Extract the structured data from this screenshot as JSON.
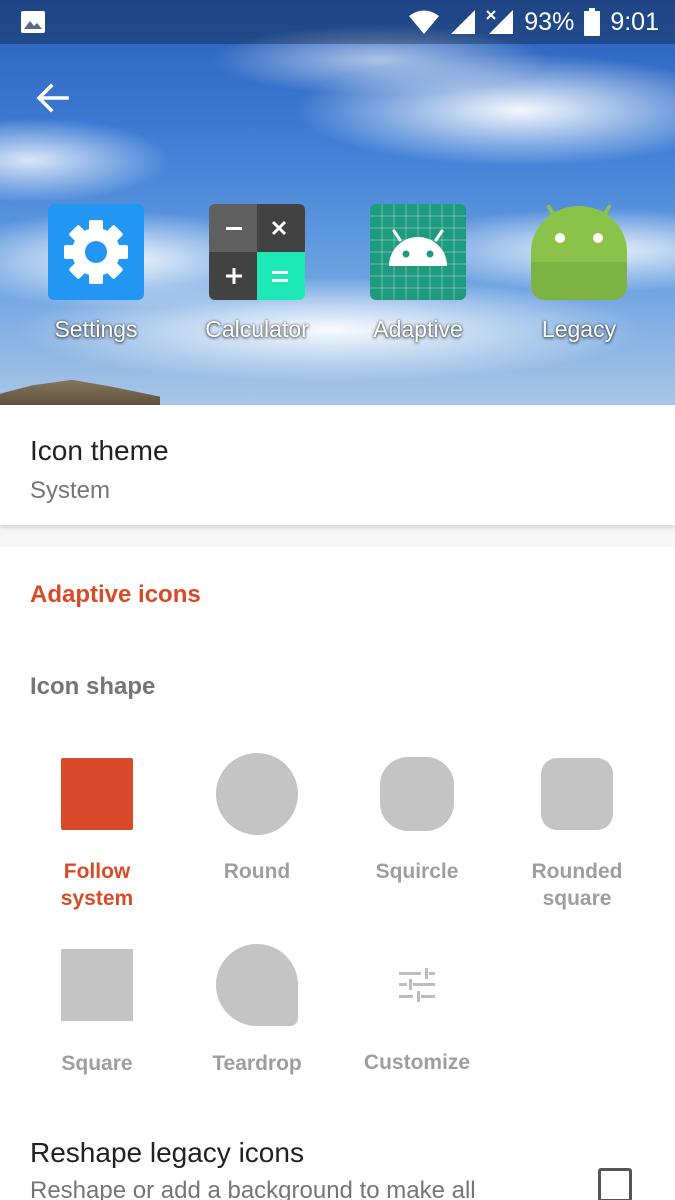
{
  "status_bar": {
    "battery_percent": "93%",
    "time": "9:01",
    "icons": [
      "gallery-icon",
      "wifi-icon",
      "signal-icon",
      "signal-no-data-icon",
      "battery-icon"
    ]
  },
  "header": {
    "back_icon": "arrow-left-icon",
    "apps": [
      {
        "label": "Settings",
        "icon": "settings-gear-icon"
      },
      {
        "label": "Calculator",
        "icon": "calculator-icon"
      },
      {
        "label": "Adaptive",
        "icon": "android-adaptive-icon"
      },
      {
        "label": "Legacy",
        "icon": "android-legacy-icon"
      }
    ]
  },
  "icon_theme": {
    "title": "Icon theme",
    "value": "System"
  },
  "adaptive": {
    "category_title": "Adaptive icons",
    "icon_shape_title": "Icon shape",
    "shapes": [
      {
        "label_line1": "Follow",
        "label_line2": "system",
        "selected": true
      },
      {
        "label_line1": "Round",
        "label_line2": "",
        "selected": false
      },
      {
        "label_line1": "Squircle",
        "label_line2": "",
        "selected": false
      },
      {
        "label_line1": "Rounded",
        "label_line2": "square",
        "selected": false
      },
      {
        "label_line1": "Square",
        "label_line2": "",
        "selected": false
      },
      {
        "label_line1": "Teardrop",
        "label_line2": "",
        "selected": false
      },
      {
        "label_line1": "Customize",
        "label_line2": "",
        "selected": false
      }
    ],
    "reshape_title": "Reshape legacy icons",
    "reshape_summary": "Reshape or add a background to make all",
    "reshape_checked": false
  },
  "colors": {
    "accent": "#d84a28",
    "shape_inactive": "#c4c4c4"
  }
}
